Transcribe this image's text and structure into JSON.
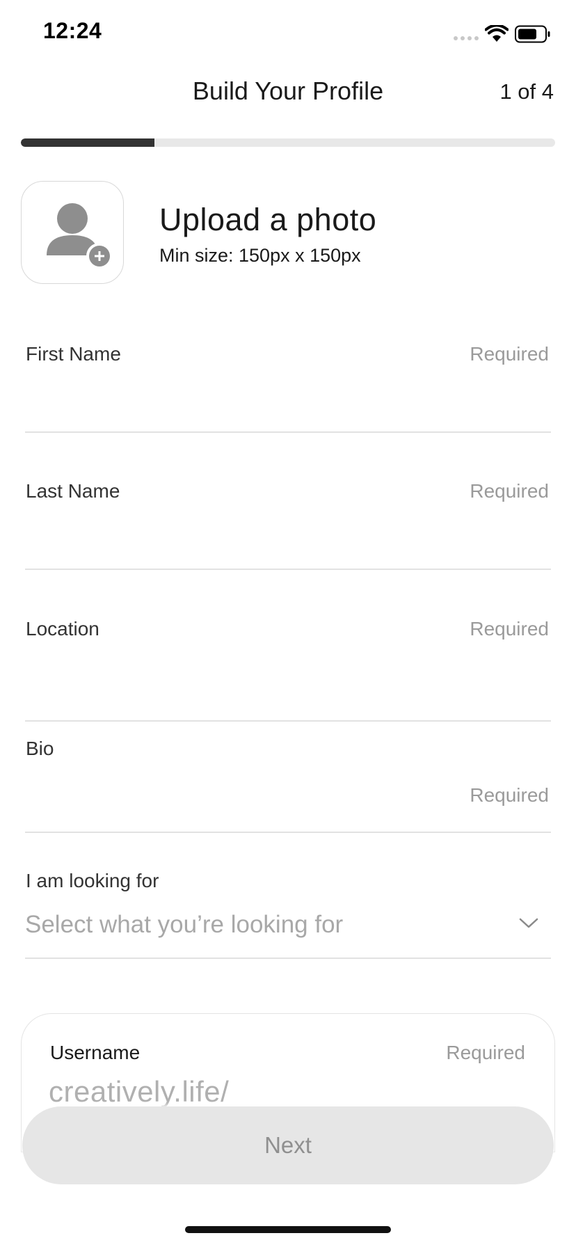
{
  "status_bar": {
    "time": "12:24",
    "signal_icon": "cellular-signal-icon",
    "wifi_icon": "wifi-icon",
    "battery_icon": "battery-icon"
  },
  "header": {
    "title": "Build Your Profile",
    "step": "1 of 4",
    "progress_fraction": 0.25,
    "progress_color": "#333333"
  },
  "photo_upload": {
    "icon": "add-user-photo-icon",
    "title": "Upload a photo",
    "subtitle": "Min size: 150px x 150px"
  },
  "fields": {
    "first_name": {
      "label": "First Name",
      "hint": "Required"
    },
    "last_name": {
      "label": "Last Name",
      "hint": "Required"
    },
    "location": {
      "label": "Location",
      "hint": "Required"
    },
    "bio": {
      "label": "Bio",
      "hint": "Required"
    }
  },
  "looking_for": {
    "label": "I am looking for",
    "placeholder": "Select what you’re looking for",
    "icon": "chevron-down-icon"
  },
  "username": {
    "label": "Username",
    "hint": "Required",
    "prefix": "creatively.life/"
  },
  "next_button": {
    "label": "Next"
  }
}
